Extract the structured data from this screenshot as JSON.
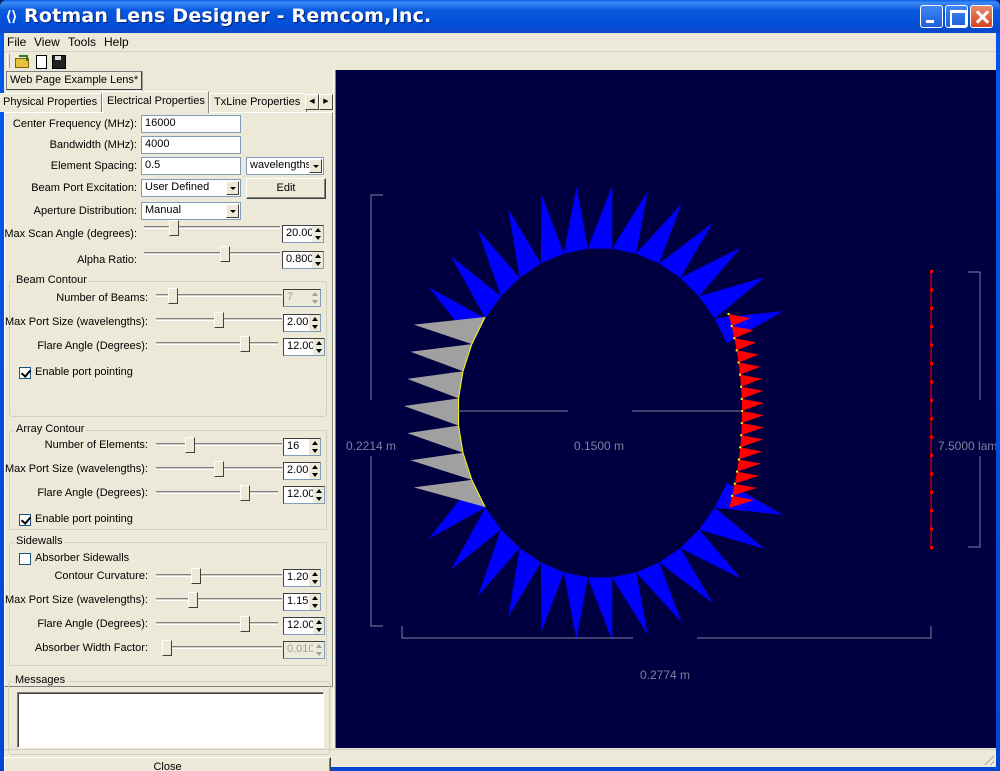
{
  "window": {
    "title": "Rotman Lens Designer - Remcom,Inc.",
    "icon": "app-icon"
  },
  "menu": [
    "File",
    "View",
    "Tools",
    "Help"
  ],
  "toolbar": {
    "icons": [
      "open-icon",
      "new-icon",
      "save-icon"
    ]
  },
  "document_tab": "Web Page Example Lens*",
  "tabs": [
    {
      "label": "Physical Properties",
      "active": false
    },
    {
      "label": "Electrical Properties",
      "active": true
    },
    {
      "label": "TxLine Properties",
      "active": false
    }
  ],
  "electrical": {
    "center_frequency": {
      "label": "Center Frequency (MHz):",
      "value": "16000"
    },
    "bandwidth": {
      "label": "Bandwidth (MHz):",
      "value": "4000"
    },
    "element_spacing": {
      "label": "Element Spacing:",
      "value": "0.5",
      "unit": "wavelengths"
    },
    "beam_port_excitation": {
      "label": "Beam Port Excitation:",
      "value": "User Defined",
      "edit_label": "Edit"
    },
    "aperture_distribution": {
      "label": "Aperture Distribution:",
      "value": "Manual"
    },
    "max_scan_angle": {
      "label": "Max Scan Angle (degrees):",
      "value": "20.00",
      "slider_fraction": 0.2
    },
    "alpha_ratio": {
      "label": "Alpha Ratio:",
      "value": "0.800",
      "slider_fraction": 0.6
    }
  },
  "beam_contour": {
    "title": "Beam Contour",
    "number_of_beams": {
      "label": "Number of Beams:",
      "value": "7",
      "slider_fraction": 0.1,
      "disabled": true
    },
    "max_port_size": {
      "label": "Max Port Size (wavelengths):",
      "value": "2.00",
      "slider_fraction": 0.5
    },
    "flare_angle": {
      "label": "Flare Angle (Degrees):",
      "value": "12.00",
      "slider_fraction": 0.75
    },
    "enable_port_pointing": {
      "label": "Enable port pointing",
      "checked": true
    }
  },
  "array_contour": {
    "title": "Array Contour",
    "number_of_elements": {
      "label": "Number of Elements:",
      "value": "16",
      "slider_fraction": 0.25
    },
    "max_port_size": {
      "label": "Max Port Size (wavelengths):",
      "value": "2.00",
      "slider_fraction": 0.5
    },
    "flare_angle": {
      "label": "Flare Angle (Degrees):",
      "value": "12.00",
      "slider_fraction": 0.75
    },
    "enable_port_pointing": {
      "label": "Enable port pointing",
      "checked": true
    }
  },
  "sidewalls": {
    "title": "Sidewalls",
    "absorber_sidewalls": {
      "label": "Absorber Sidewalls",
      "checked": false
    },
    "contour_curvature": {
      "label": "Contour Curvature:",
      "value": "1.20",
      "slider_fraction": 0.3
    },
    "max_port_size": {
      "label": "Max Port Size (wavelengths):",
      "value": "1.15",
      "slider_fraction": 0.28
    },
    "flare_angle": {
      "label": "Flare Angle (Degrees):",
      "value": "12.00",
      "slider_fraction": 0.75
    },
    "absorber_width_factor": {
      "label": "Absorber Width Factor:",
      "value": "0.010",
      "slider_fraction": 0.0,
      "disabled": true
    }
  },
  "messages": {
    "title": "Messages",
    "text": ""
  },
  "close_label": "Close",
  "canvas": {
    "colors": {
      "background": "#000040",
      "beam_ports": "#a0a0a0",
      "sidewall_ports": "#0000ff",
      "array_ports": "#ff0000",
      "contour": "#ffff00",
      "dimension": "#8080a0"
    },
    "dimensions": {
      "height": "0.2214 m",
      "focal_length": "0.1500 m",
      "width": "0.2774 m",
      "aperture": "7.5000 lam"
    },
    "beam_port_count": 7,
    "array_element_count": 16,
    "sidewall_port_count_top": 13,
    "sidewall_port_count_bottom": 13
  }
}
